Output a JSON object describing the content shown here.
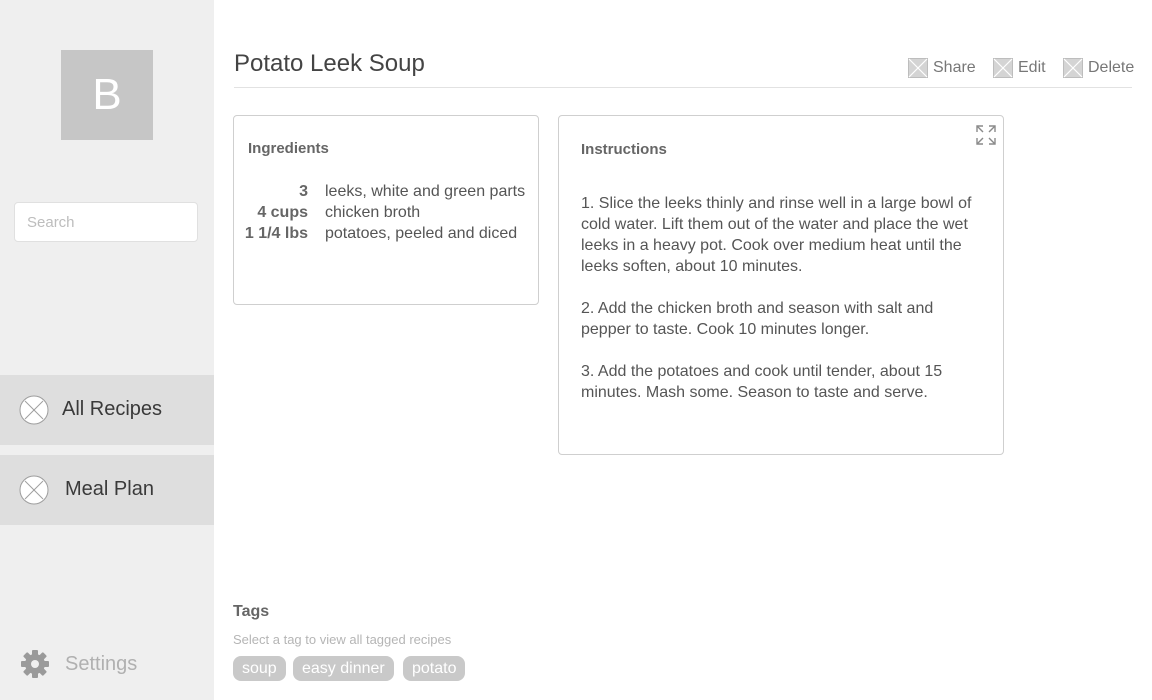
{
  "sidebar": {
    "avatar_letter": "B",
    "search_placeholder": "Search",
    "nav": [
      {
        "label": "All Recipes",
        "icon": "placeholder-circle-icon"
      },
      {
        "label": "Meal Plan",
        "icon": "placeholder-circle-icon"
      }
    ],
    "settings_label": "Settings"
  },
  "recipe": {
    "title": "Potato Leek Soup",
    "actions": {
      "share": "Share",
      "edit": "Edit",
      "delete": "Delete"
    }
  },
  "ingredients": {
    "heading": "Ingredients",
    "items": [
      {
        "qty": "3",
        "name": "leeks, white and green parts"
      },
      {
        "qty": "4 cups",
        "name": "chicken broth"
      },
      {
        "qty": "1 1/4 lbs",
        "name": "potatoes, peeled and diced"
      }
    ]
  },
  "instructions": {
    "heading": "Instructions",
    "steps": [
      "1. Slice the leeks thinly and rinse well in a large bowl of cold water. Lift them out of the water and place the wet leeks in a heavy pot. Cook over medium heat until the leeks soften, about 10 minutes.",
      "2. Add the chicken broth and season with salt and pepper to taste. Cook 10 minutes longer.",
      "3. Add the potatoes and cook until tender, about 15 minutes. Mash some. Season to taste and serve."
    ]
  },
  "tags": {
    "heading": "Tags",
    "hint": "Select a tag to view all tagged recipes",
    "items": [
      "soup",
      "easy dinner",
      "potato"
    ]
  },
  "colors": {
    "sidebar_bg": "#efefef",
    "nav_bg": "#dedede",
    "tag_bg": "#c9c9c9",
    "avatar_bg": "#c6c6c6"
  }
}
